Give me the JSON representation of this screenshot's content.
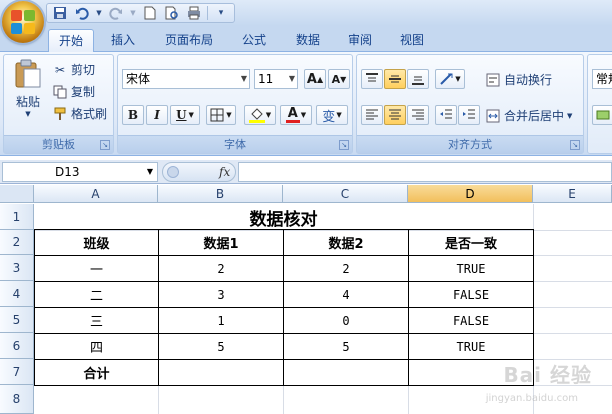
{
  "quick_access": {
    "icons": [
      "save-icon",
      "undo-icon",
      "redo-icon",
      "new-document-icon",
      "print-preview-icon",
      "print-icon",
      "customize-icon"
    ]
  },
  "tabs": [
    {
      "label": "开始",
      "active": true
    },
    {
      "label": "插入",
      "active": false
    },
    {
      "label": "页面布局",
      "active": false
    },
    {
      "label": "公式",
      "active": false
    },
    {
      "label": "数据",
      "active": false
    },
    {
      "label": "审阅",
      "active": false
    },
    {
      "label": "视图",
      "active": false
    }
  ],
  "ribbon": {
    "clipboard": {
      "label": "剪贴板",
      "paste": "粘贴",
      "cut": "剪切",
      "copy": "复制",
      "format_painter": "格式刷"
    },
    "font": {
      "label": "字体",
      "font_name": "宋体",
      "font_size": "11",
      "bold": "B",
      "italic": "I",
      "underline": "U",
      "grow": "A",
      "shrink": "A",
      "font_color_letter": "A",
      "phonetic": "变"
    },
    "alignment": {
      "label": "对齐方式",
      "wrap_text": "自动换行",
      "merge_center": "合并后居中"
    },
    "number": {
      "format": "常规"
    }
  },
  "formula_bar": {
    "name_box": "D13",
    "fx": "fx",
    "content": ""
  },
  "columns": [
    "A",
    "B",
    "C",
    "D",
    "E"
  ],
  "rows": [
    "1",
    "2",
    "3",
    "4",
    "5",
    "6",
    "7",
    "8"
  ],
  "sheet": {
    "title": "数据核对",
    "headers": [
      "班级",
      "数据1",
      "数据2",
      "是否一致"
    ],
    "data": [
      [
        "一",
        "2",
        "2",
        "TRUE"
      ],
      [
        "二",
        "3",
        "4",
        "FALSE"
      ],
      [
        "三",
        "1",
        "0",
        "FALSE"
      ],
      [
        "四",
        "5",
        "5",
        "TRUE"
      ]
    ],
    "total_label": "合计"
  },
  "watermark": {
    "text": "Bai 经验",
    "sub": "jingyan.baidu.com"
  },
  "colors": {
    "ribbon_blue": "#c5d8f0",
    "selected_col": "#f2bf5c",
    "font_color_bar": "#e02020",
    "highlight_bar": "#ffff00"
  }
}
